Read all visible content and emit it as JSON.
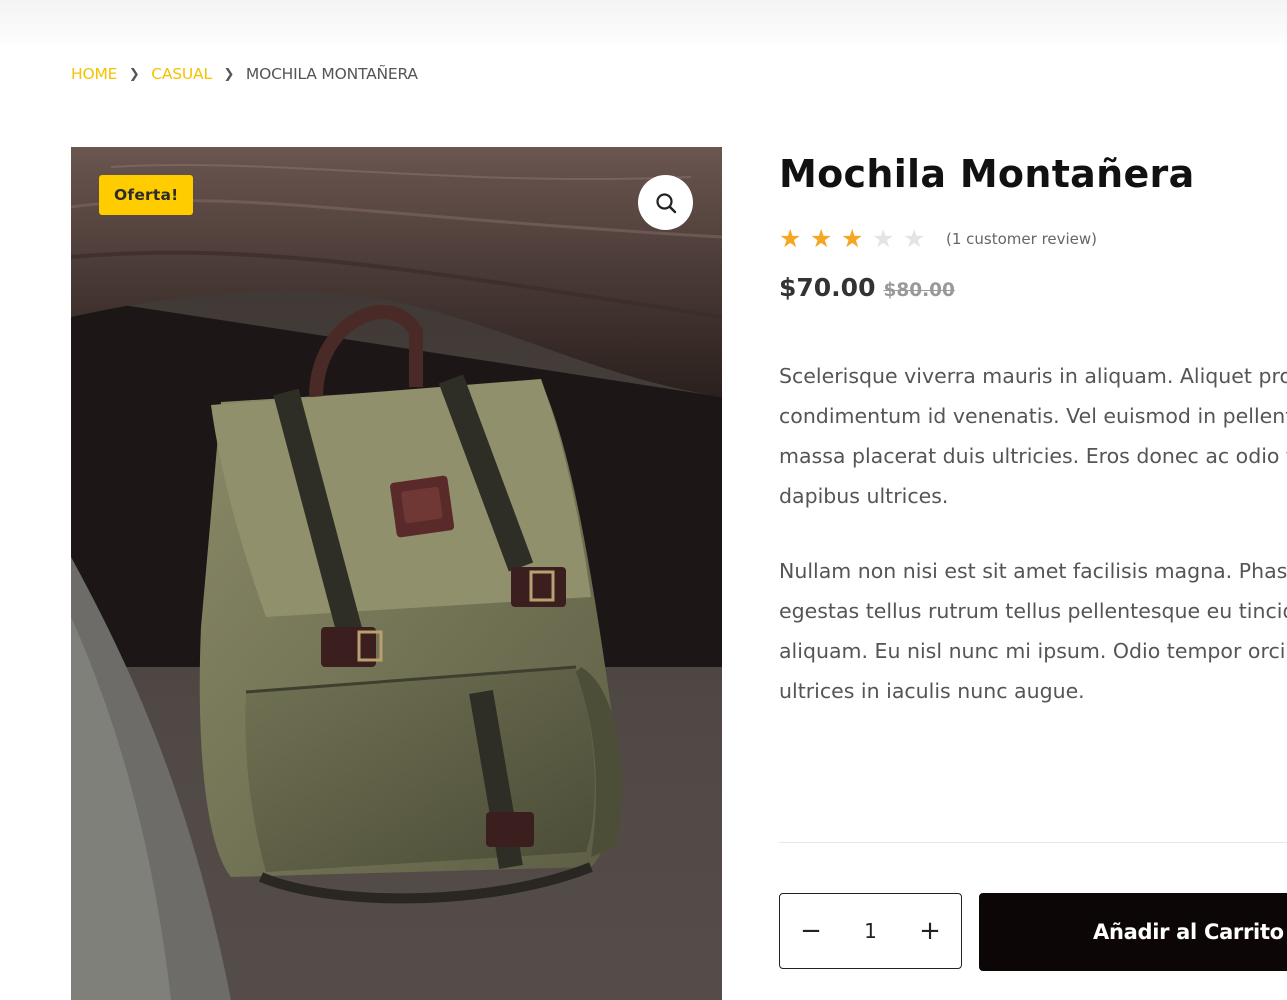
{
  "breadcrumb": {
    "home": "Home",
    "category": "Casual",
    "current": "Mochila Montañera"
  },
  "product": {
    "badge": "Oferta!",
    "zoom_icon": "search-icon",
    "title": "Mochila Montañera",
    "rating": {
      "value": 3,
      "max": 5
    },
    "review_text": "(1 customer review)",
    "price_current": "$70.00",
    "price_old": "$80.00",
    "description": [
      "Scelerisque viverra mauris in aliquam. Aliquet proin nibh nisl condimentum id venenatis. Vel euismod in pellentesque massa placerat duis ultricies. Eros donec ac odio tempor orci dapibus ultrices.",
      "Nullam non nisi est sit amet facilisis magna. Phasellus egestas tellus rutrum tellus pellentesque eu tincidunt tortor aliquam. Eu nisl nunc mi ipsum. Odio tempor orci dapibus ultrices in iaculis nunc augue."
    ]
  },
  "cart": {
    "quantity": "1",
    "minus_symbol": "−",
    "plus_symbol": "+",
    "add_label": "Añadir al Carrito"
  },
  "colors": {
    "accent": "#ffcc00",
    "star": "#f5a623",
    "button_bg": "#0c0706"
  }
}
